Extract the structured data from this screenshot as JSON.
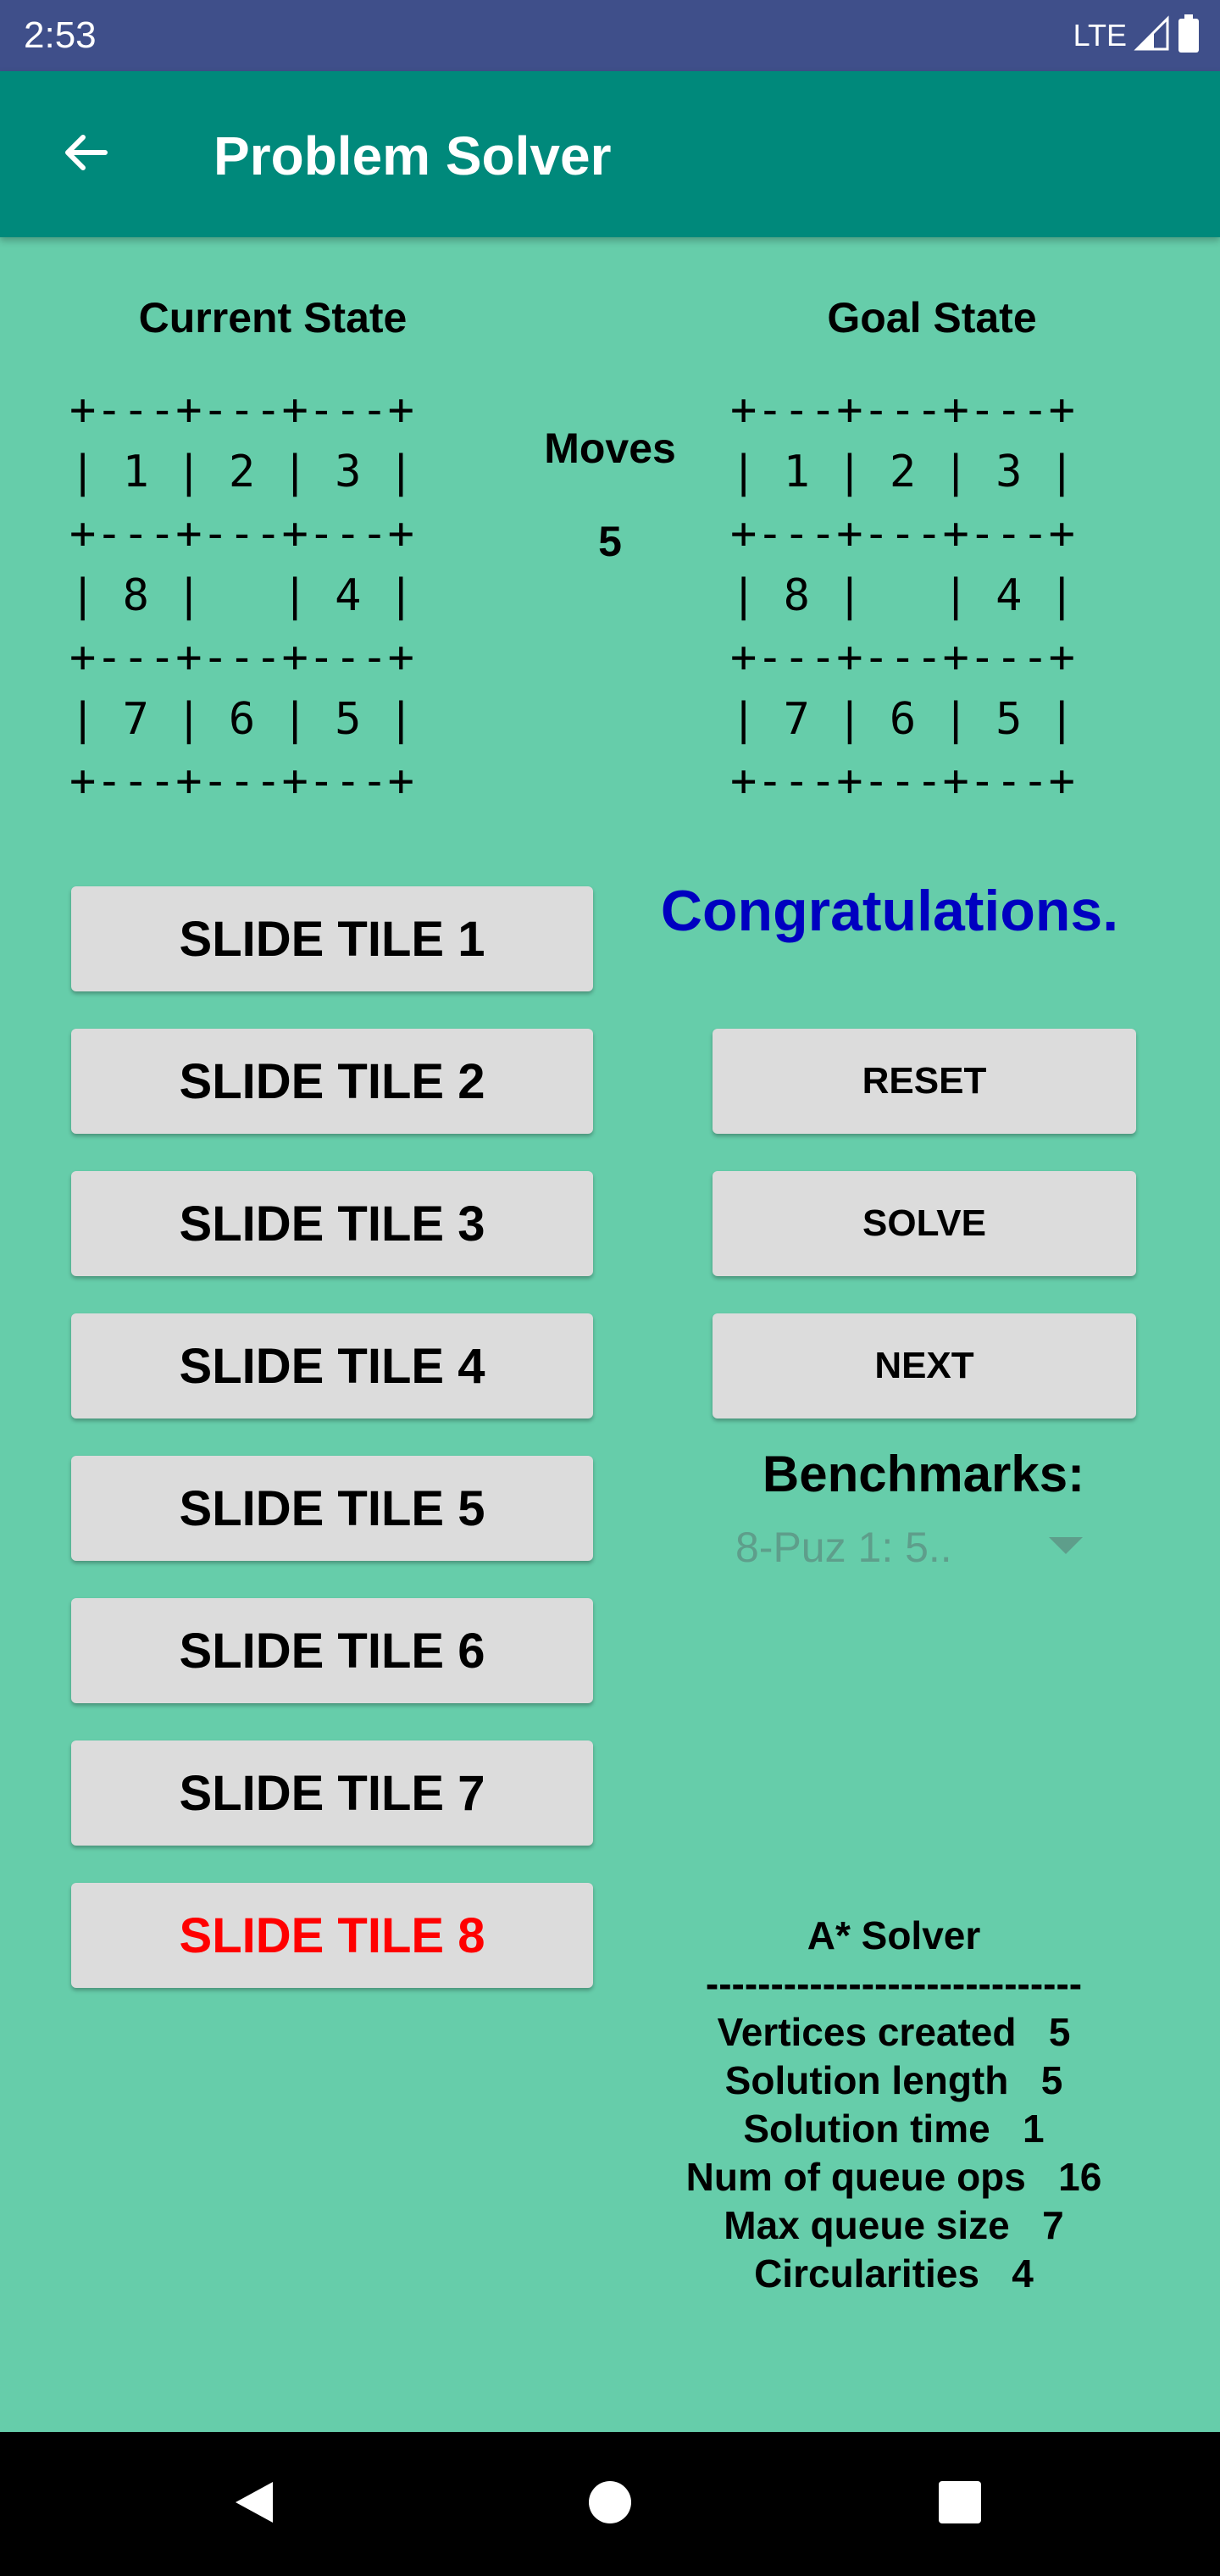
{
  "status_bar": {
    "time": "2:53",
    "network": "LTE"
  },
  "app_bar": {
    "title": "Problem Solver",
    "back_icon": "arrow-back-icon"
  },
  "current_state": {
    "title": "Current State",
    "grid_text": "+---+---+---+\n| 1 | 2 | 3 |\n+---+---+---+\n| 8 |   | 4 |\n+---+---+---+\n| 7 | 6 | 5 |\n+---+---+---+"
  },
  "goal_state": {
    "title": "Goal State",
    "grid_text": "+---+---+---+\n| 1 | 2 | 3 |\n+---+---+---+\n| 8 |   | 4 |\n+---+---+---+\n| 7 | 6 | 5 |\n+---+---+---+"
  },
  "moves": {
    "label": "Moves",
    "value": "5"
  },
  "message": "Congratulations.",
  "slide_buttons": [
    {
      "label": "SLIDE TILE 1"
    },
    {
      "label": "SLIDE TILE 2"
    },
    {
      "label": "SLIDE TILE 3"
    },
    {
      "label": "SLIDE TILE 4"
    },
    {
      "label": "SLIDE TILE 5"
    },
    {
      "label": "SLIDE TILE 6"
    },
    {
      "label": "SLIDE TILE 7"
    },
    {
      "label": "SLIDE TILE 8"
    }
  ],
  "highlight_color": "#FF0000",
  "actions": {
    "reset": "RESET",
    "solve": "SOLVE",
    "next": "NEXT"
  },
  "benchmarks": {
    "title": "Benchmarks:",
    "selected": "8-Puz 1: 5.."
  },
  "solver": {
    "title": "A* Solver",
    "separator": "-----------------------------",
    "stats": [
      "Vertices created   5",
      "Solution length   5",
      "Solution time   1",
      "Num of queue ops   16",
      "Max queue size   7",
      "Circularities   4"
    ]
  },
  "colors": {
    "background": "#66CDAA",
    "app_bar": "#00897B",
    "status_bar": "#3F4F8A",
    "message": "#0000C0",
    "button": "#DCDCDC"
  }
}
